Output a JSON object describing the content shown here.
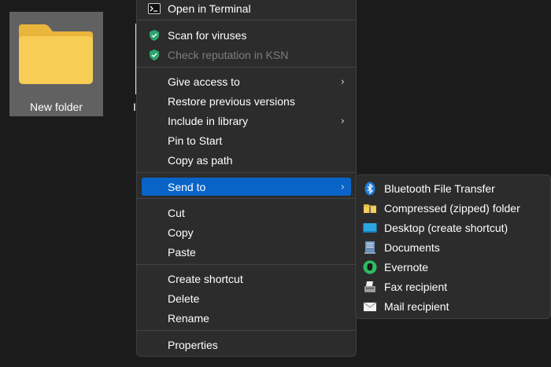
{
  "desktop": {
    "folder_label": "New folder",
    "second_item_partial_label": "In"
  },
  "menu": {
    "items": [
      {
        "label": "Open in Terminal",
        "icon": "terminal-icon"
      },
      {
        "label": "Scan for viruses",
        "icon": "kaspersky-shield-icon"
      },
      {
        "label": "Check reputation in KSN",
        "icon": "kaspersky-shield-icon",
        "disabled": true
      },
      {
        "label": "Give access to",
        "submenu": true
      },
      {
        "label": "Restore previous versions"
      },
      {
        "label": "Include in library",
        "submenu": true
      },
      {
        "label": "Pin to Start"
      },
      {
        "label": "Copy as path"
      },
      {
        "label": "Send to",
        "submenu": true,
        "active": true
      },
      {
        "label": "Cut"
      },
      {
        "label": "Copy"
      },
      {
        "label": "Paste"
      },
      {
        "label": "Create shortcut"
      },
      {
        "label": "Delete"
      },
      {
        "label": "Rename"
      },
      {
        "label": "Properties"
      }
    ],
    "chevron": "›"
  },
  "send_to": {
    "items": [
      {
        "label": "Bluetooth File Transfer",
        "icon": "bluetooth-icon"
      },
      {
        "label": "Compressed (zipped) folder",
        "icon": "zip-folder-icon"
      },
      {
        "label": "Desktop (create shortcut)",
        "icon": "desktop-icon"
      },
      {
        "label": "Documents",
        "icon": "documents-icon"
      },
      {
        "label": "Evernote",
        "icon": "evernote-icon"
      },
      {
        "label": "Fax recipient",
        "icon": "fax-icon"
      },
      {
        "label": "Mail recipient",
        "icon": "mail-icon"
      }
    ]
  },
  "colors": {
    "highlight": "#0a64c8",
    "menu_bg": "#2c2c2c",
    "shield_green": "#2ea36e"
  }
}
